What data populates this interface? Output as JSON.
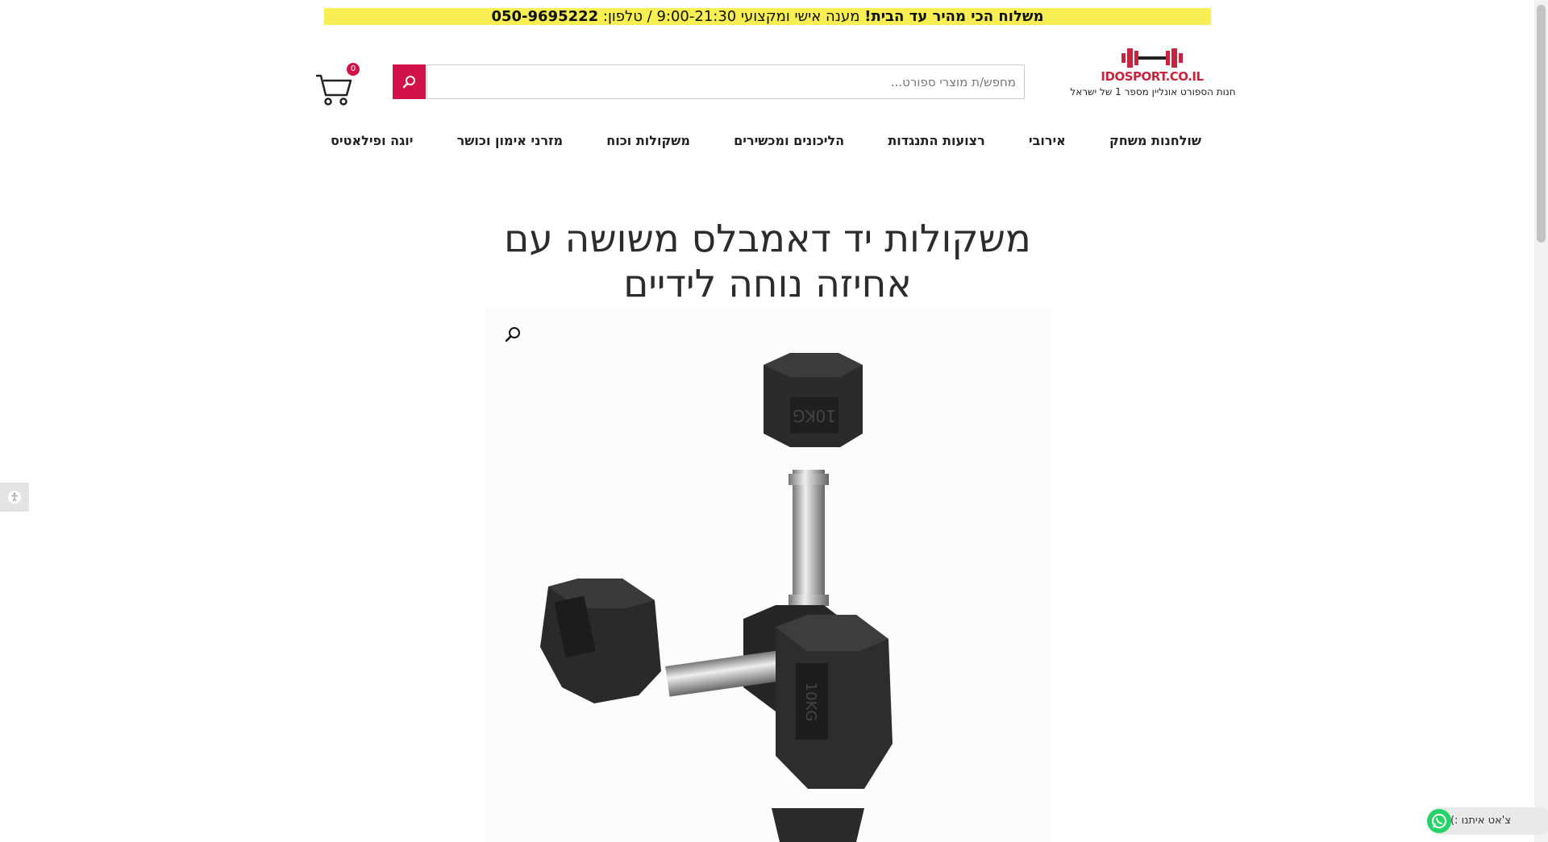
{
  "announcement": {
    "bold_text": "משלוח הכי מהיר עד הבית!",
    "regular_text": "מענה אישי ומקצועי 9:00-21:30 / טלפון:",
    "phone": "050-9695222"
  },
  "logo": {
    "brand": "IDOSPORT.CO.IL",
    "tagline": "חנות הספורט אונליין מספר 1 של ישראל",
    "brand_color": "#c6253f"
  },
  "search": {
    "placeholder": "מחפש/ת מוצרי ספורט...",
    "button_icon": "search-icon",
    "button_color": "#d1114a"
  },
  "cart": {
    "count": "0",
    "icon": "cart-icon"
  },
  "nav": {
    "items": [
      "יוגה ופילאטיס",
      "מזרני אימון וכושר",
      "משקולות וכוח",
      "הליכונים ומכשירים",
      "רצועות התנגדות",
      "אירובי",
      "שולחנות משחק"
    ]
  },
  "product": {
    "title": "משקולות יד דאמבלס משושה עם אחיזה נוחה לידיים",
    "image_icon": "hex-dumbbells-image",
    "zoom_icon": "zoom-icon"
  },
  "accessibility": {
    "icon": "accessibility-icon"
  },
  "chat": {
    "label": "צ'אט איתנו :)",
    "icon": "whatsapp-icon",
    "color": "#25d366"
  }
}
